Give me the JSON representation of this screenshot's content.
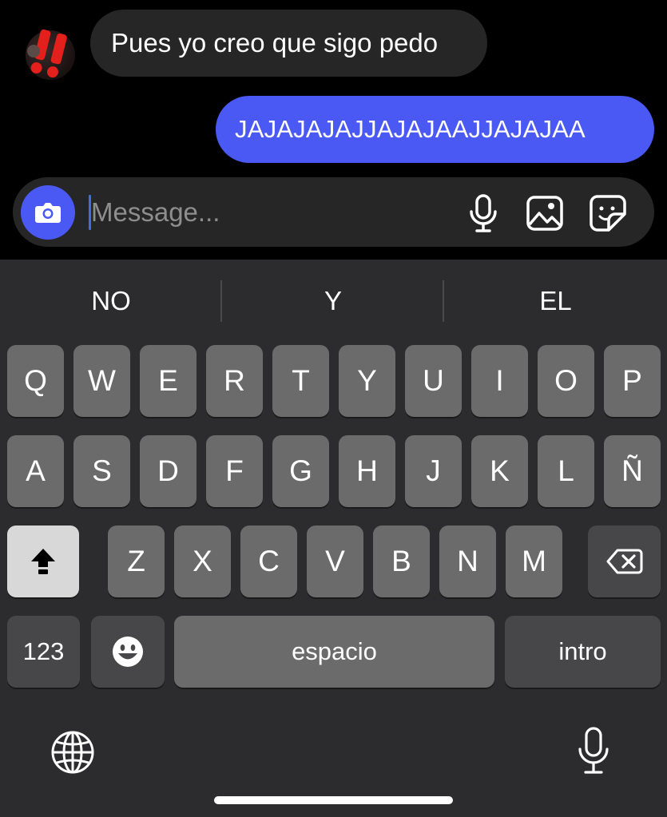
{
  "chat": {
    "incoming_message": "Pues yo creo que sigo pedo",
    "outgoing_message": "JAJAJAJAJJAJAJAAJJAJAJAA"
  },
  "composer": {
    "placeholder": "Message...",
    "icons": [
      "camera-icon",
      "microphone-icon",
      "image-icon",
      "sticker-icon"
    ]
  },
  "keyboard": {
    "suggestions": [
      "NO",
      "Y",
      "EL"
    ],
    "row1": [
      "Q",
      "W",
      "E",
      "R",
      "T",
      "Y",
      "U",
      "I",
      "O",
      "P"
    ],
    "row2": [
      "A",
      "S",
      "D",
      "F",
      "G",
      "H",
      "J",
      "K",
      "L",
      "Ñ"
    ],
    "row3": [
      "Z",
      "X",
      "C",
      "V",
      "B",
      "N",
      "M"
    ],
    "numbers_label": "123",
    "space_label": "espacio",
    "return_label": "intro",
    "icons": [
      "shift-icon",
      "backspace-icon",
      "emoji-icon",
      "globe-icon",
      "dictation-icon"
    ]
  },
  "colors": {
    "accent": "#4a59f3",
    "background": "#000000",
    "bubble_incoming": "#262626",
    "keyboard_bg": "#2c2c2e",
    "key": "#6b6b6b",
    "key_dark": "#474749"
  }
}
